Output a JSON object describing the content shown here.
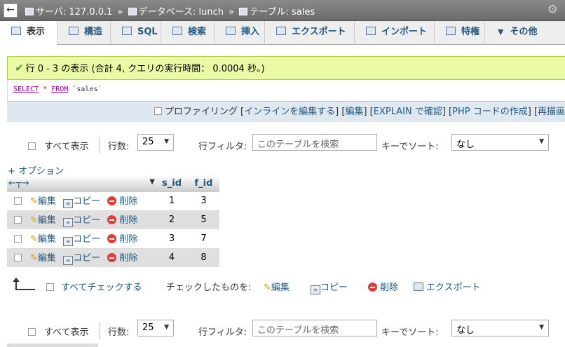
{
  "breadcrumb": {
    "back": "←",
    "server": "サーバ: 127.0.0.1",
    "database": "データベース: lunch",
    "table": "テーブル: sales",
    "sep": "»"
  },
  "tabs": [
    {
      "label": "表示",
      "icon": "browse-icon"
    },
    {
      "label": "構造",
      "icon": "structure-icon"
    },
    {
      "label": "SQL",
      "icon": "sql-icon"
    },
    {
      "label": "検索",
      "icon": "search-icon"
    },
    {
      "label": "挿入",
      "icon": "insert-icon"
    },
    {
      "label": "エクスポート",
      "icon": "export-icon"
    },
    {
      "label": "インポート",
      "icon": "import-icon"
    },
    {
      "label": "特権",
      "icon": "privileges-icon"
    },
    {
      "label": "その他",
      "icon": "chevron-down-icon"
    }
  ],
  "message": {
    "text": "行 0 - 3 の表示 (合計 4, クエリの実行時間： 0.0004 秒。)",
    "status_color": "#43a047"
  },
  "sql": {
    "select": "SELECT",
    "star": "*",
    "from": "FROM",
    "table": "`sales`"
  },
  "profiling": {
    "checkbox_label": "プロファイリング",
    "links": [
      "インラインを編集する",
      "編集",
      "EXPLAIN で確認",
      "PHP コードの作成",
      "再描画"
    ]
  },
  "nav": {
    "show_all": "すべて表示",
    "rows_label": "行数:",
    "rows_value": "25",
    "filter_label": "行フィルタ:",
    "filter_placeholder": "このテーブルを検索",
    "sort_label": "キーでソート:",
    "sort_value": "なし"
  },
  "options_link": "+ オプション",
  "table": {
    "columns": [
      "s_id",
      "f_id"
    ],
    "action_labels": {
      "edit": "編集",
      "copy": "コピー",
      "delete": "削除"
    },
    "rows": [
      {
        "s_id": "1",
        "f_id": "3"
      },
      {
        "s_id": "2",
        "f_id": "5"
      },
      {
        "s_id": "3",
        "f_id": "7"
      },
      {
        "s_id": "4",
        "f_id": "8"
      }
    ]
  },
  "bulk": {
    "check_all": "すべてチェックする",
    "with_selected": "チェックしたものを:",
    "edit": "編集",
    "copy": "コピー",
    "delete": "削除",
    "export": "エクスポート"
  },
  "colors": {
    "link": "#235a81",
    "success_bg": "#ebf8a4",
    "success_border": "#a2d246"
  }
}
